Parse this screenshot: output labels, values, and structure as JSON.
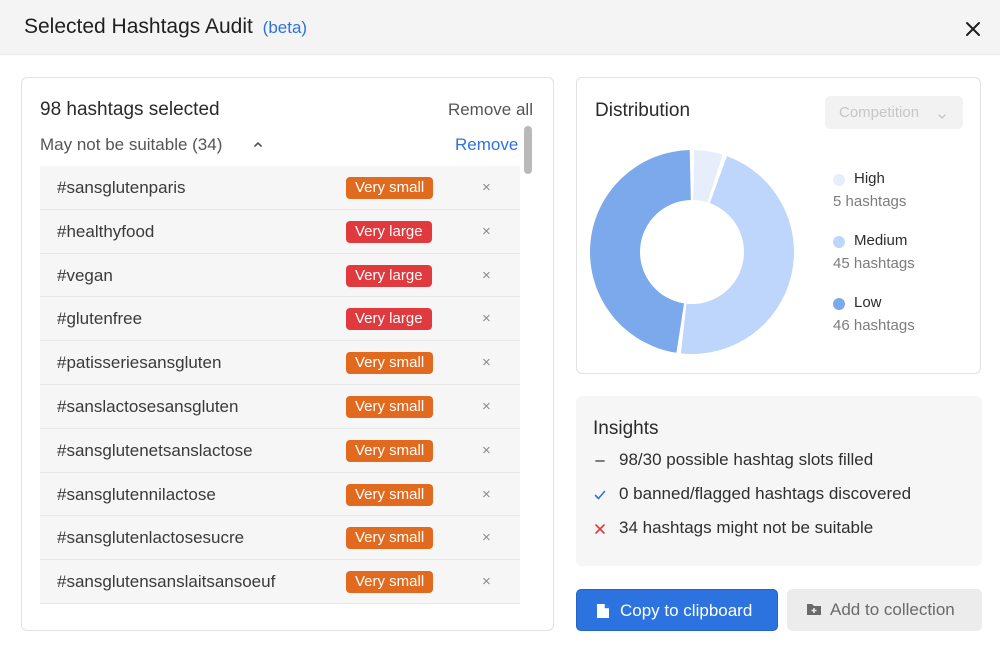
{
  "dialog": {
    "title": "Selected Hashtags Audit",
    "beta_label": "(beta)",
    "close_icon": "close-icon"
  },
  "selection": {
    "count_label": "98 hashtags selected",
    "remove_all_label": "Remove all",
    "group": {
      "title": "May not be suitable (34)",
      "remove_label": "Remove",
      "chevron_icon": "chevron-up-icon"
    },
    "tags": [
      {
        "name": "#sansglutenparis",
        "badge": "Very small",
        "level": "small"
      },
      {
        "name": "#healthyfood",
        "badge": "Very large",
        "level": "large"
      },
      {
        "name": "#vegan",
        "badge": "Very large",
        "level": "large"
      },
      {
        "name": "#glutenfree",
        "badge": "Very large",
        "level": "large"
      },
      {
        "name": "#patisseriesansgluten",
        "badge": "Very small",
        "level": "small"
      },
      {
        "name": "#sanslactosesansgluten",
        "badge": "Very small",
        "level": "small"
      },
      {
        "name": "#sansglutenetsanslactose",
        "badge": "Very small",
        "level": "small"
      },
      {
        "name": "#sansglutennilactose",
        "badge": "Very small",
        "level": "small"
      },
      {
        "name": "#sansglutenlactosesucre",
        "badge": "Very small",
        "level": "small"
      },
      {
        "name": "#sansglutensanslaitsansoeuf",
        "badge": "Very small",
        "level": "small"
      }
    ],
    "remove_tag_symbol": "×"
  },
  "distribution": {
    "title": "Distribution",
    "filter": {
      "selected": "Competition"
    },
    "legend": [
      {
        "name": "High",
        "count_label": "5 hashtags",
        "color": "#e6eefc"
      },
      {
        "name": "Medium",
        "count_label": "45 hashtags",
        "color": "#bed6fb"
      },
      {
        "name": "Low",
        "count_label": "46 hashtags",
        "color": "#7ba9eb"
      }
    ],
    "segments": [
      {
        "name": "High",
        "value": 5,
        "color": "#e6eefc"
      },
      {
        "name": "Medium",
        "value": 45,
        "color": "#bed6fb"
      },
      {
        "name": "Low",
        "value": 46,
        "color": "#7ba9eb"
      }
    ]
  },
  "insights": {
    "title": "Insights",
    "items": [
      {
        "icon": "dash-icon",
        "text": "98/30 possible hashtag slots filled",
        "color": "#555555"
      },
      {
        "icon": "check-icon",
        "text": "0 banned/flagged hashtags discovered",
        "color": "#2d73df"
      },
      {
        "icon": "cross-icon",
        "text": "34 hashtags might not be suitable",
        "color": "#e0393e"
      }
    ]
  },
  "actions": {
    "copy_label": "Copy to clipboard",
    "copy_icon": "clipboard-icon",
    "add_label": "Add to collection",
    "add_icon": "folder-add-icon"
  }
}
